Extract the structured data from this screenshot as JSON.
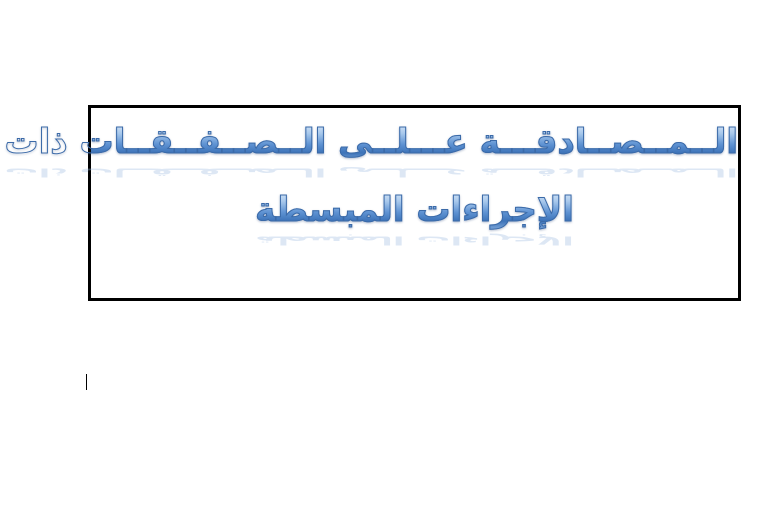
{
  "document": {
    "title_line_1": "الــمــصــادقـــة عـــلــى الــصــفــقــات ذات",
    "title_line_2": "الإجراءات المبسطة"
  },
  "colors": {
    "title_gradient_light": "#e7f1fb",
    "title_gradient_mid": "#5f93d3",
    "title_gradient_dark": "#3d73b8",
    "frame_border": "#000000",
    "page_background": "#ffffff"
  }
}
